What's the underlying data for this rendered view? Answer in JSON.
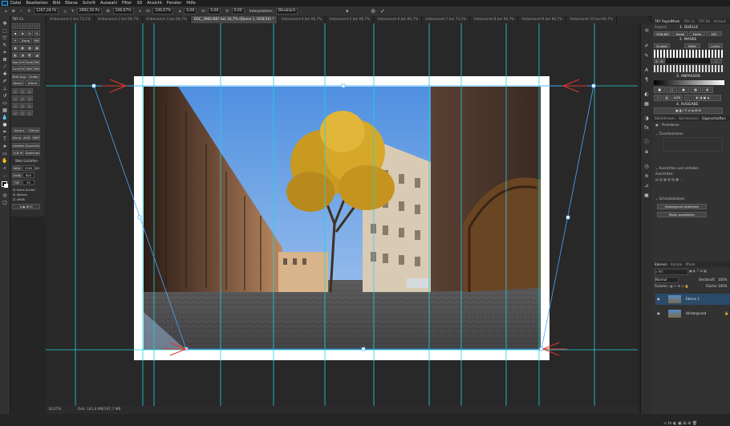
{
  "menu": [
    "Datei",
    "Bearbeiten",
    "Bild",
    "Ebene",
    "Schrift",
    "Auswahl",
    "Filter",
    "3D",
    "Ansicht",
    "Fenster",
    "Hilfe"
  ],
  "options": {
    "x_value": "1267,28 Px",
    "y_value": "2992,50 Px",
    "w_value": "106,67%",
    "h_value": "106,67%",
    "angle": "0,00",
    "h_skew": "0,00",
    "v_skew": "0,00",
    "interpolation": "Bikubisch"
  },
  "tabs": [
    {
      "label": "Unbenannt-1 bei 73,1%",
      "active": false
    },
    {
      "label": "Unbenannt-2 bei 66,7%",
      "active": false
    },
    {
      "label": "Unbenannt-3 bei 66,7%",
      "active": false
    },
    {
      "label": "DSC_3960.NEF bei 16,7% (Ebene 1, RGB/16) *",
      "active": true
    },
    {
      "label": "Unbenannt-4 bei 66,7%",
      "active": false
    },
    {
      "label": "Unbenannt-5 bei 66,7%",
      "active": false
    },
    {
      "label": "Unbenannt-6 bei 66,7%",
      "active": false
    },
    {
      "label": "Unbenannt-7 bei 73,1%",
      "active": false
    },
    {
      "label": "Unbenannt-8 bei 66,7%",
      "active": false
    },
    {
      "label": "Unbenannt-9 bei 66,7%",
      "active": false
    },
    {
      "label": "Unbenannt-10 bei 66,7%",
      "active": false
    }
  ],
  "tky_left": {
    "title": "TKY Cc",
    "rows": [
      [
        "Swap",
        "Mit"
      ],
      [
        "Norm",
        "Hl",
        "Farbe",
        "Mit"
      ],
      [
        "Lum",
        "Hl",
        "Sätt",
        "Mit"
      ],
      [
        "Bild Augen",
        "Größe"
      ],
      [
        "Reduz",
        "Arbeit"
      ],
      [
        "Kontur",
        "Fläche"
      ],
      [
        "Dunkel",
        "AOR",
        "BRP"
      ],
      [
        "Umkehren",
        "Ausrichten"
      ],
      [
        "A-B-M",
        "Speichern"
      ]
    ],
    "web_label": "Web-Schärfen",
    "web_value": "2560",
    "web_px": "px",
    "size_label": "Größe",
    "size_value": "800",
    "fill_label": "Füll",
    "fill_value": "50",
    "checks": [
      "Extra Schärf",
      "Aktiver",
      "sRGB"
    ]
  },
  "status": {
    "zoom": "16,67%",
    "doc": "Dok: 181,4 MB/197,7 MB"
  },
  "right_panel": {
    "header_tabs": [
      "TKY RapidMask",
      "TKY Cc",
      "TKY Ba",
      "Verlauf",
      "Anpass"
    ],
    "section1": "1. QUELLE",
    "quelle_buttons": [
      "RGB-BM",
      "Kanal",
      "Farbe",
      "SAT"
    ],
    "section2": "2. MASKE",
    "mask_buttons": [
      "Dunkel",
      "Mitte",
      "Lights"
    ],
    "section3": "3. ANPASSEN",
    "section4": "4. AUSGABE",
    "ausgabe_buttons": [
      "AGB"
    ],
    "props_tabs": [
      "Bibliotheken",
      "Korrekturen",
      "Eigenschaften"
    ],
    "props_type": "Pixelebene",
    "transform_label": "Transformieren",
    "align_label": "Ausrichten und verteilen",
    "align_sub": "Ausrichten:",
    "quick_label": "Schnellaktionen",
    "quick_buttons": [
      "Hintergrund entfernen",
      "Motiv auswählen"
    ],
    "layers_tabs": [
      "Ebenen",
      "Kanäle",
      "Pfade"
    ],
    "blend_mode": "Normal",
    "opacity_label": "Deckkraft:",
    "opacity_value": "100%",
    "fill_label": "Fläche:",
    "fill_value": "100%",
    "lock_label": "Fixieren:",
    "search_label": "Art",
    "layers": [
      {
        "name": "Ebene 1",
        "selected": true
      },
      {
        "name": "Hintergrund",
        "selected": false
      }
    ]
  },
  "colors": {
    "guide": "#1fd3dc",
    "accent": "#31a8ff",
    "selected_layer": "#2b4a68",
    "transform_box": "#4aa6ff"
  }
}
